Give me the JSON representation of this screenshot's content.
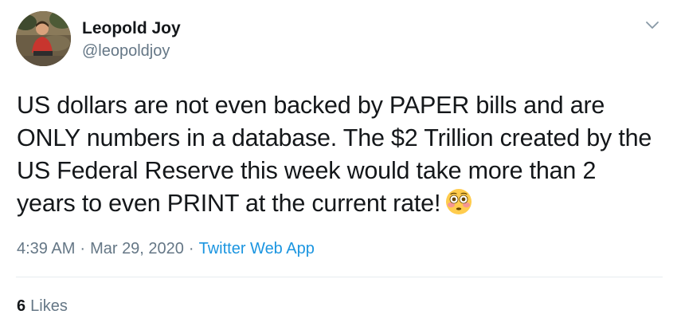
{
  "author": {
    "name": "Leopold Joy",
    "handle": "@leopoldjoy",
    "avatar_icon": "profile-photo"
  },
  "tweet": {
    "text": "US dollars are not even backed by PAPER bills and are ONLY numbers in a database. The $2 Trillion created by the US Federal Reserve this week would take more than 2 years to even PRINT at the current rate!",
    "emoji": "flushed-face-emoji"
  },
  "meta": {
    "time": "4:39 AM",
    "separator": "·",
    "date": "Mar 29, 2020",
    "source": "Twitter Web App"
  },
  "stats": {
    "likes_count": "6",
    "likes_label": "Likes"
  },
  "menu": {
    "icon": "chevron-down-icon"
  },
  "colors": {
    "text": "#14171a",
    "secondary": "#657786",
    "link": "#1b95e0",
    "divider": "#e6ecf0"
  }
}
